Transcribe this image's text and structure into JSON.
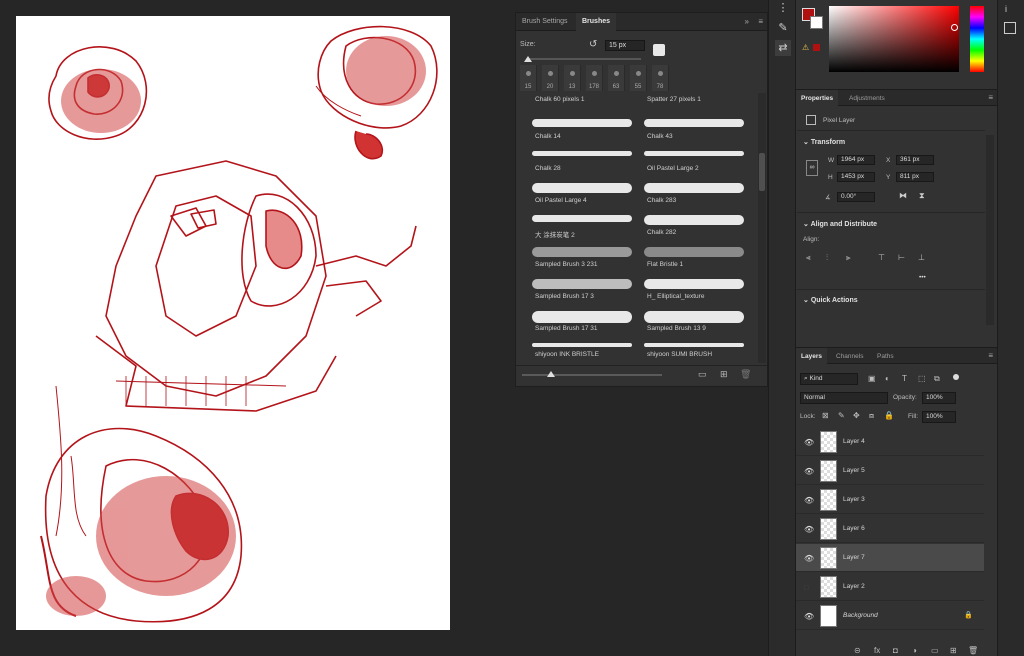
{
  "brushes_panel": {
    "tabs": [
      "Brush Settings",
      "Brushes"
    ],
    "active_tab": "Brushes",
    "size_label": "Size:",
    "size_value": "15 px",
    "recent_presets": [
      "15",
      "20",
      "13",
      "178",
      "63",
      "55",
      "78"
    ],
    "brushes": [
      {
        "name": "Chalk 60 pixels 1"
      },
      {
        "name": "Spatter 27 pixels 1"
      },
      {
        "name": "Chalk 14"
      },
      {
        "name": "Chalk 43"
      },
      {
        "name": "Chalk 28"
      },
      {
        "name": "Oil Pastel Large 2"
      },
      {
        "name": "Oil Pastel Large 4"
      },
      {
        "name": "Chalk 283"
      },
      {
        "name": "大 涂抹炭笔 2"
      },
      {
        "name": "Chalk 282"
      },
      {
        "name": "Sampled Brush 3 231"
      },
      {
        "name": "Flat Bristle 1"
      },
      {
        "name": "Sampled Brush 17 3"
      },
      {
        "name": "H_ Elliptical_texture"
      },
      {
        "name": "Sampled Brush 17 31"
      },
      {
        "name": "Sampled Brush 13 9"
      },
      {
        "name": "shiyoon INK BRISTLE"
      },
      {
        "name": "shiyoon SUMI BRUSH"
      }
    ]
  },
  "colors": {
    "foreground": "#b01010",
    "background": "#ffffff",
    "sketch": "#b3141a"
  },
  "properties_panel": {
    "tabs": [
      "Properties",
      "Adjustments"
    ],
    "layer_type": "Pixel Layer",
    "transform_title": "Transform",
    "w_label": "W",
    "w_value": "1964 px",
    "x_label": "X",
    "x_value": "361 px",
    "h_label": "H",
    "h_value": "1453 px",
    "y_label": "Y",
    "y_value": "811 px",
    "angle_value": "0.00°",
    "align_title": "Align and Distribute",
    "align_label": "Align:",
    "quick_actions_title": "Quick Actions",
    "more": "•••"
  },
  "layers_panel": {
    "tabs": [
      "Layers",
      "Channels",
      "Paths"
    ],
    "filter_kind": "Kind",
    "blend_mode": "Normal",
    "opacity_label": "Opacity:",
    "opacity_value": "100%",
    "lock_label": "Lock:",
    "fill_label": "Fill:",
    "fill_value": "100%",
    "layers": [
      {
        "name": "Layer 4",
        "visible": true
      },
      {
        "name": "Layer 5",
        "visible": true
      },
      {
        "name": "Layer 3",
        "visible": true
      },
      {
        "name": "Layer 6",
        "visible": true
      },
      {
        "name": "Layer 7",
        "visible": true,
        "selected": true
      },
      {
        "name": "Layer 2",
        "visible": false
      },
      {
        "name": "Background",
        "visible": true,
        "locked": true
      }
    ]
  }
}
